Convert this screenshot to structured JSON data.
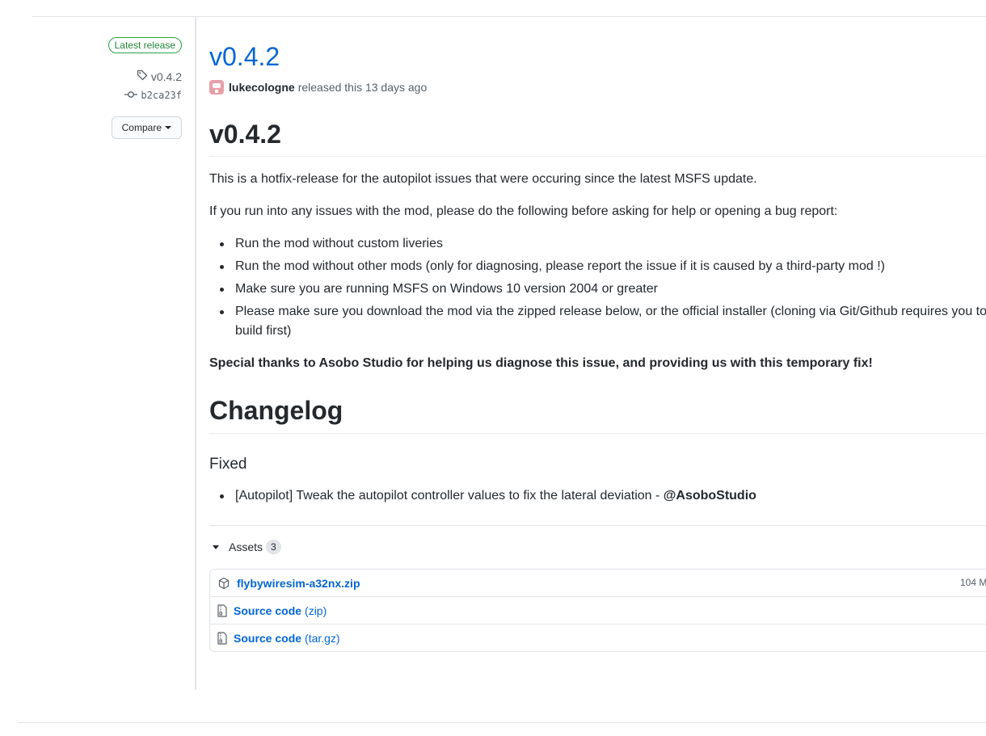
{
  "meta": {
    "latest_badge": "Latest release",
    "tag": "v0.4.2",
    "commit": "b2ca23f",
    "compare_label": "Compare"
  },
  "release": {
    "title": "v0.4.2",
    "author": "lukecologne",
    "released_text": "released this 13 days ago"
  },
  "body": {
    "heading": "v0.4.2",
    "intro": "This is a hotfix-release for the autopilot issues that were occuring since the latest MSFS update.",
    "instructions": "If you run into any issues with the mod, please do the following before asking for help or opening a bug report:",
    "bullets": [
      "Run the mod without custom liveries",
      "Run the mod without other mods (only for diagnosing, please report the issue if it is caused by a third-party mod !)",
      "Make sure you are running MSFS on Windows 10 version 2004 or greater",
      "Please make sure you download the mod via the zipped release below, or the official installer (cloning via Git/Github requires you to",
      "build first)"
    ],
    "thanks": "Special thanks to Asobo Studio for helping us diagnose this issue, and providing us with this temporary fix!",
    "changelog_heading": "Changelog",
    "fixed_heading": "Fixed",
    "fixed_item_text": "[Autopilot] Tweak the autopilot controller values to fix the lateral deviation - ",
    "fixed_item_mention": "@AsoboStudio"
  },
  "assets": {
    "label": "Assets",
    "count": "3",
    "items": [
      {
        "name": "flybywiresim-a32nx.zip",
        "suffix": "",
        "size": "104 M",
        "icon": "package-icon"
      },
      {
        "name": "Source code",
        "suffix": "(zip)",
        "size": "",
        "icon": "file-zip-icon"
      },
      {
        "name": "Source code",
        "suffix": "(tar.gz)",
        "size": "",
        "icon": "file-zip-icon"
      }
    ]
  }
}
